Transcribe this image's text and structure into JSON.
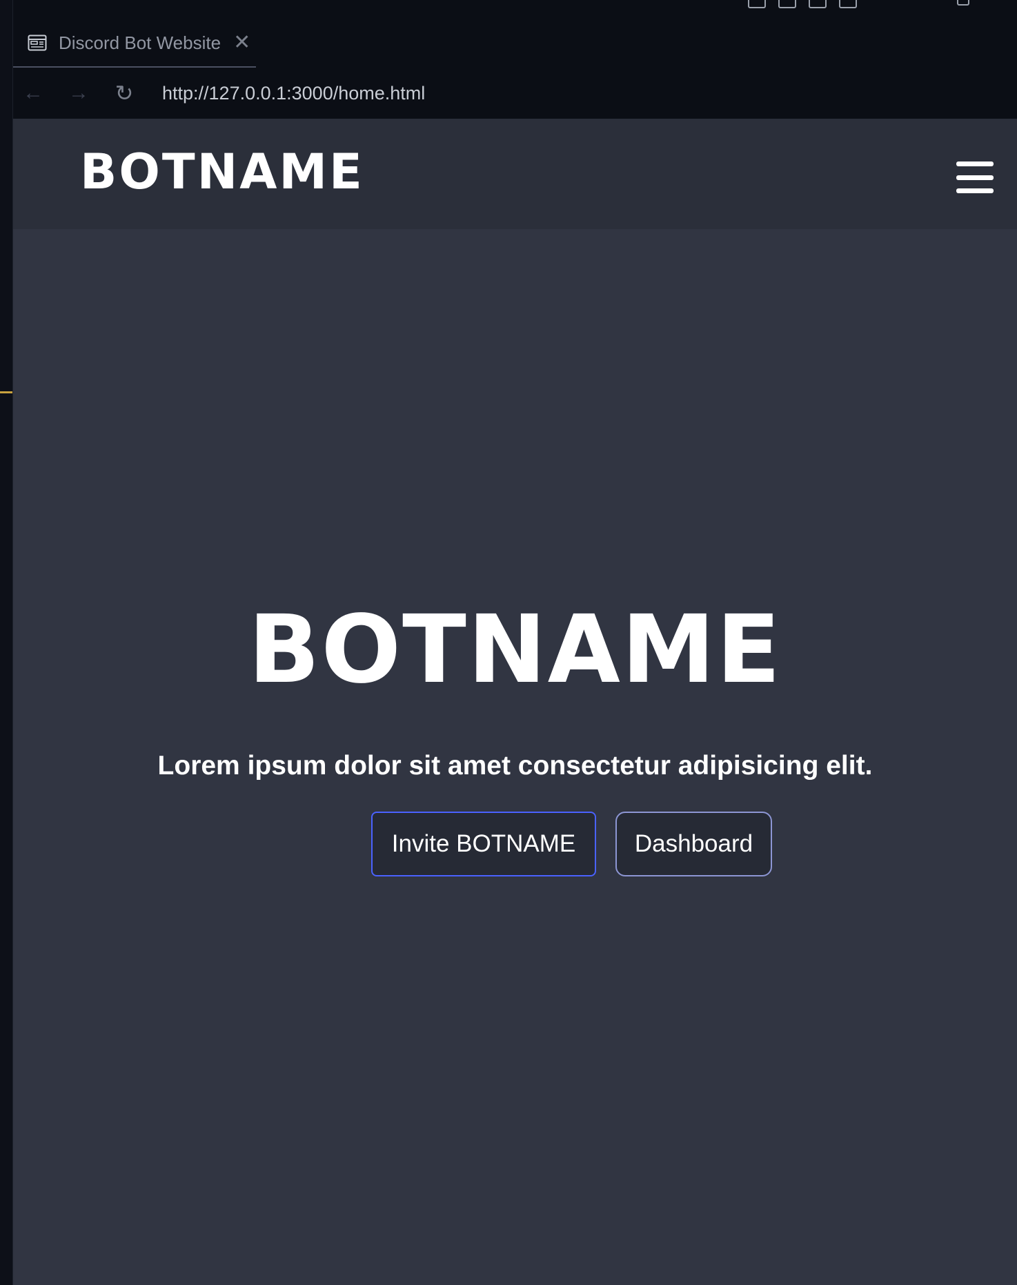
{
  "tab": {
    "title": "Discord Bot Website",
    "icon": "webpage-icon",
    "close_glyph": "✕"
  },
  "address_bar": {
    "url": "http://127.0.0.1:3000/home.html",
    "back_glyph": "←",
    "forward_glyph": "→",
    "reload_glyph": "↻"
  },
  "site": {
    "nav": {
      "logo": "BOTNAME",
      "menu_icon": "hamburger-menu-icon"
    },
    "hero": {
      "title": "BOTNAME",
      "subtitle": "Lorem ipsum dolor sit amet consectetur adipisicing elit.",
      "buttons": [
        {
          "label": "Invite BOTNAME"
        },
        {
          "label": "Dashboard"
        }
      ]
    }
  },
  "colors": {
    "page_background": "#313542",
    "nav_background": "#2b2f3a",
    "invite_border": "#4a62ff",
    "dashboard_border": "#8d96d4",
    "editor_accent": "#c9a23f"
  }
}
